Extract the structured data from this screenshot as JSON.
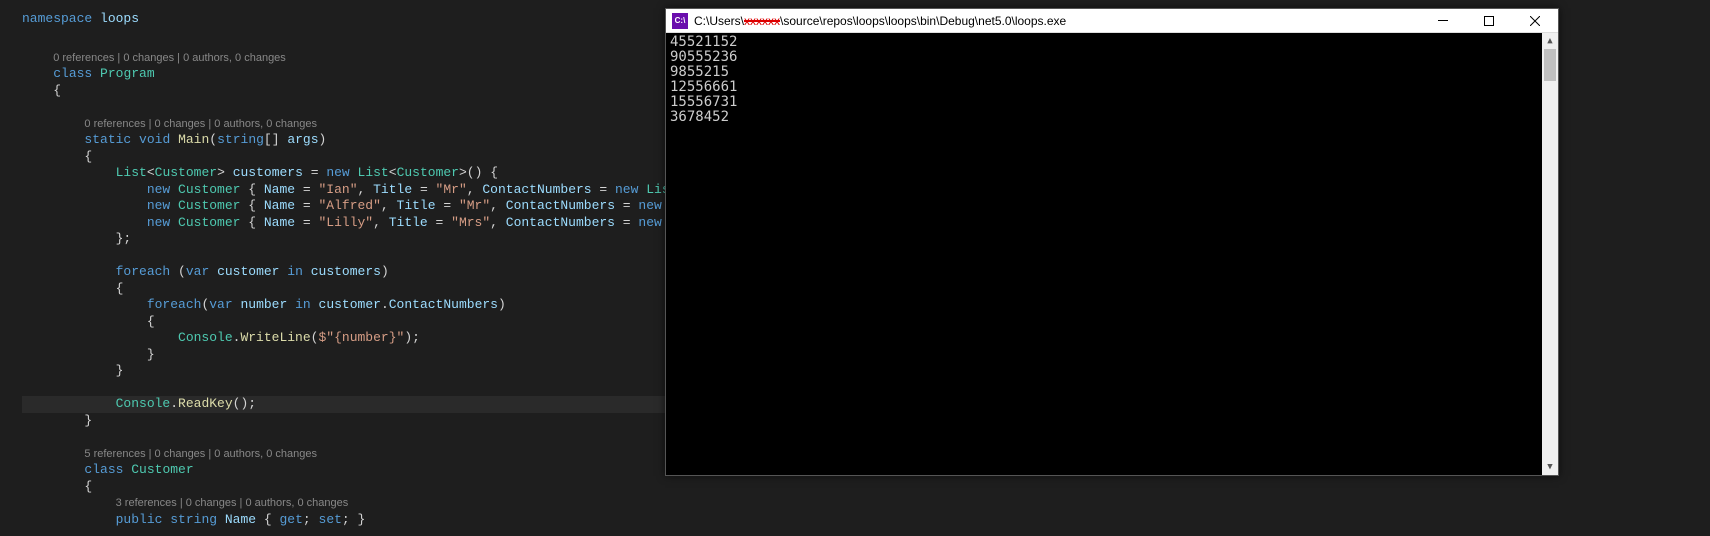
{
  "editor": {
    "namespace_kw": "namespace",
    "namespace_name": "loops",
    "codelens_program": "0 references | 0 changes | 0 authors, 0 changes",
    "class_kw": "class",
    "program_name": "Program",
    "codelens_main": "0 references | 0 changes | 0 authors, 0 changes",
    "static_kw": "static",
    "void_kw": "void",
    "main_name": "Main",
    "string_kw": "string",
    "args_name": "args",
    "list_type": "List",
    "customer_type": "Customer",
    "customers_var": "customers",
    "new_kw": "new",
    "name_prop": "Name",
    "title_prop": "Title",
    "contact_prop": "ContactNumbers",
    "ian_name": "\"Ian\"",
    "ian_title": "\"Mr\"",
    "alfred_name": "\"Alfred\"",
    "alfred_title": "\"Mr\"",
    "lilly_name": "\"Lilly\"",
    "lilly_title": "\"Mrs\"",
    "foreach_kw": "foreach",
    "var_kw": "var",
    "customer_var": "customer",
    "in_kw": "in",
    "number_var": "number",
    "console_type": "Console",
    "writeline_method": "WriteLine",
    "interp": "$\"{number}\"",
    "readkey_method": "ReadKey",
    "codelens_customer": "5 references | 0 changes | 0 authors, 0 changes",
    "customer_class": "Customer",
    "codelens_name": "3 references | 0 changes | 0 authors, 0 changes",
    "public_kw": "public",
    "string_type": "string",
    "name_prop2": "Name",
    "get_kw": "get",
    "set_kw": "set"
  },
  "console": {
    "title_prefix": "C:\\Users\\",
    "title_redacted": "xxxxxx",
    "title_suffix": "\\source\\repos\\loops\\loops\\bin\\Debug\\net5.0\\loops.exe",
    "icon_text": "C:\\",
    "lines": [
      "45521152",
      "90555236",
      "9855215",
      "12556661",
      "15556731",
      "3678452"
    ]
  }
}
